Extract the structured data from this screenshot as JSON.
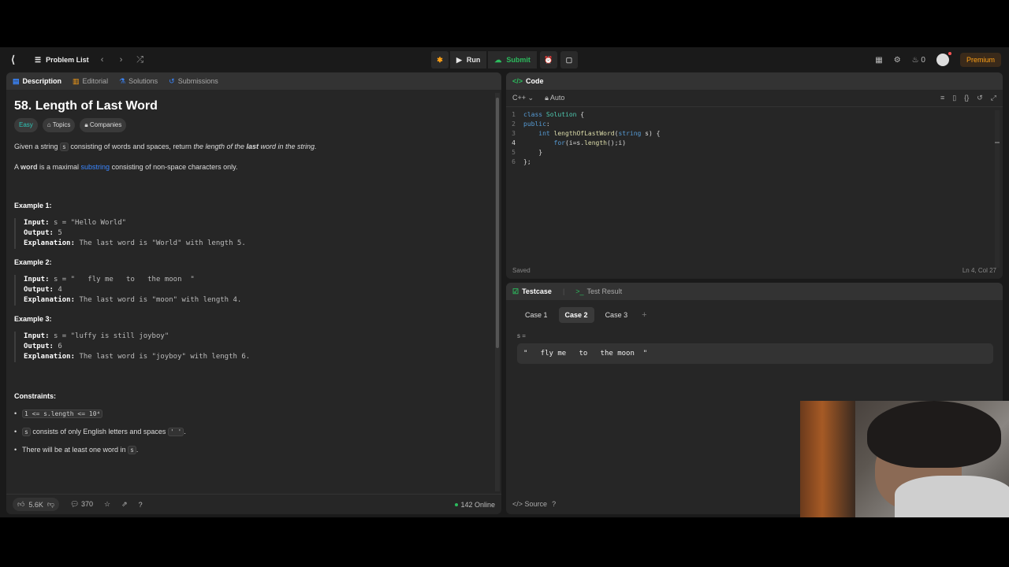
{
  "topnav": {
    "problem_list": "Problem List",
    "run": "Run",
    "submit": "Submit",
    "streak": "0",
    "premium": "Premium"
  },
  "desc": {
    "tabs": [
      "Description",
      "Editorial",
      "Solutions",
      "Submissions"
    ],
    "title": "58. Length of Last Word",
    "tags": [
      "Easy",
      "Topics",
      "Companies"
    ],
    "p1_a": "Given a string ",
    "p1_code": "s",
    "p1_b": " consisting of words and spaces, return ",
    "p1_c": "the length of the ",
    "p1_d": "last",
    "p1_e": " word in the string.",
    "p2_a": "A ",
    "p2_b": "word",
    "p2_c": " is a maximal ",
    "p2_link": "substring",
    "p2_d": " consisting of non-space characters only.",
    "examples": [
      {
        "title": "Example 1:",
        "input": "s = \"Hello World\"",
        "output": "5",
        "explanation": "The last word is \"World\" with length 5."
      },
      {
        "title": "Example 2:",
        "input": "s = \"   fly me   to   the moon  \"",
        "output": "4",
        "explanation": "The last word is \"moon\" with length 4."
      },
      {
        "title": "Example 3:",
        "input": "s = \"luffy is still joyboy\"",
        "output": "6",
        "explanation": "The last word is \"joyboy\" with length 6."
      }
    ],
    "labels": {
      "input": "Input:",
      "output": "Output:",
      "explanation": "Explanation:"
    },
    "constraints_title": "Constraints:",
    "c1_code": "1 <= s.length <= 10⁴",
    "c2_code": "s",
    "c2_text": " consists of only English letters and spaces ",
    "c2_code2": "' '",
    "c2_end": ".",
    "c3_text": "There will be at least one word in ",
    "c3_code": "s",
    "c3_end": ".",
    "footer": {
      "likes": "5.6K",
      "comments": "370",
      "online": "142 Online"
    }
  },
  "code": {
    "tab": "Code",
    "language": "C++",
    "mode": "Auto",
    "line_numbers": [
      "1",
      "2",
      "3",
      "4",
      "5",
      "6"
    ],
    "saved": "Saved",
    "cursor": "Ln 4, Col 27"
  },
  "test": {
    "tabs": [
      "Testcase",
      "Test Result"
    ],
    "cases": [
      "Case 1",
      "Case 2",
      "Case 3"
    ],
    "plus": "+",
    "var_label": "s =",
    "value": "\"   fly me   to   the moon  \"",
    "source": "Source"
  }
}
